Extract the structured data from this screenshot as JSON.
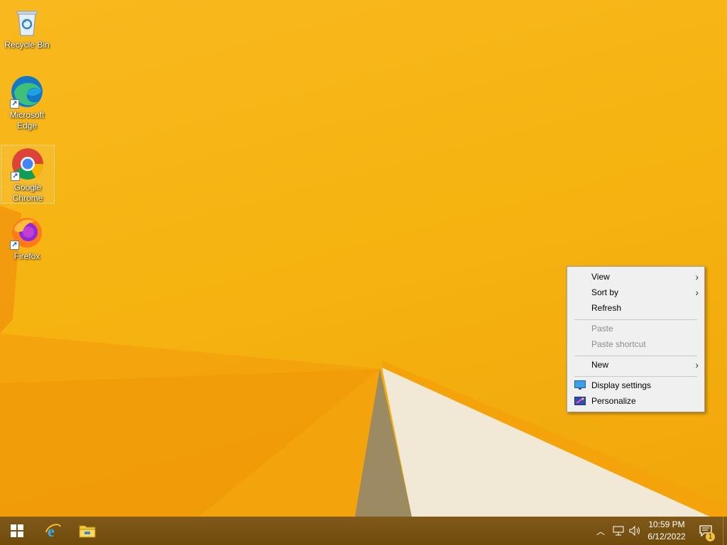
{
  "desktop": {
    "icons": [
      {
        "label": "Recycle Bin",
        "icon": "recycle-bin-icon"
      },
      {
        "label": "Microsoft Edge",
        "icon": "edge-icon"
      },
      {
        "label": "Google Chrome",
        "icon": "chrome-icon"
      },
      {
        "label": "Firefox",
        "icon": "firefox-icon"
      }
    ]
  },
  "context_menu": {
    "items": [
      {
        "label": "View",
        "submenu": true,
        "enabled": true
      },
      {
        "label": "Sort by",
        "submenu": true,
        "enabled": true
      },
      {
        "label": "Refresh",
        "enabled": true
      },
      {
        "label": "Paste",
        "enabled": false
      },
      {
        "label": "Paste shortcut",
        "enabled": false
      },
      {
        "label": "New",
        "submenu": true,
        "enabled": true
      },
      {
        "label": "Display settings",
        "icon": "display-icon",
        "enabled": true
      },
      {
        "label": "Personalize",
        "icon": "personalize-icon",
        "enabled": true
      }
    ]
  },
  "taskbar": {
    "pinned": [
      "start-icon",
      "internet-explorer-icon",
      "file-explorer-icon"
    ],
    "clock": {
      "time": "10:59 PM",
      "date": "6/12/2022"
    },
    "notification_count": "1"
  },
  "colors": {
    "wallpaper": "#f6b411",
    "taskbar": "#7a5511",
    "menu_bg": "#f0f0f0"
  }
}
